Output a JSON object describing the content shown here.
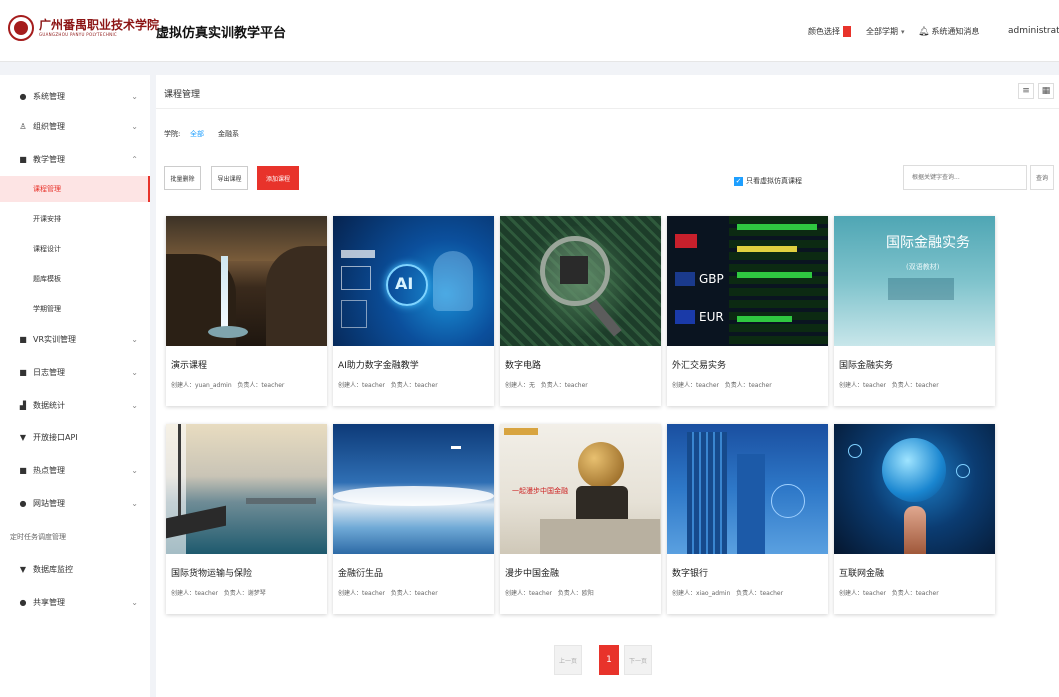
{
  "header": {
    "logo_cn": "广州番禺职业技术学院",
    "logo_en": "GUANGZHOU PANYU POLYTECHNIC",
    "platform_title": "虚拟仿真实训教学平台",
    "color_label": "颜色选择",
    "accent_color": "#e8332b",
    "term_label": "全部学期",
    "notify_label": "系统通知消息",
    "user": "administrator"
  },
  "sidebar": {
    "items": [
      {
        "icon": "circle-icon",
        "label": "系统管理"
      },
      {
        "icon": "user-icon",
        "label": "组织管理"
      },
      {
        "icon": "book-icon",
        "label": "教学管理"
      }
    ],
    "sub_items": [
      "课程管理",
      "开课安排",
      "课程设计",
      "题库模板",
      "学期管理"
    ],
    "more_items": [
      {
        "icon": "vr-icon",
        "label": "VR实训管理"
      },
      {
        "icon": "log-icon",
        "label": "日志管理"
      },
      {
        "icon": "chart-icon",
        "label": "数据统计"
      },
      {
        "icon": "funnel-icon",
        "label": "开放接口API"
      },
      {
        "icon": "hot-icon",
        "label": "热点管理"
      },
      {
        "icon": "web-icon",
        "label": "网站管理"
      }
    ],
    "plain_item": "定时任务调度管理",
    "bottom_items": [
      {
        "icon": "funnel-icon",
        "label": "数据库监控"
      },
      {
        "icon": "share-icon",
        "label": "共享管理"
      }
    ]
  },
  "main": {
    "page_title": "课程管理",
    "filter_label": "学院:",
    "filter_options": [
      "全部",
      "金融系"
    ],
    "buttons": {
      "batch_delete": "批量删除",
      "export": "导出课程",
      "add": "添加课程"
    },
    "checkbox_label": "只看虚拟仿真课程",
    "search_placeholder": "根据关键字查询...",
    "search_button": "查询"
  },
  "courses": [
    {
      "title": "演示课程",
      "creator": "创建人：yuan_admin",
      "owner": "负责人：teacher",
      "image": "waterfall-scene"
    },
    {
      "title": "AI助力数字金融教学",
      "creator": "创建人：teacher",
      "owner": "负责人：teacher",
      "image": "ai-robot-scene"
    },
    {
      "title": "数字电路",
      "creator": "创建人：无",
      "owner": "负责人：teacher",
      "image": "circuit-board-scene"
    },
    {
      "title": "外汇交易实务",
      "creator": "创建人：teacher",
      "owner": "负责人：teacher",
      "image": "forex-board-scene"
    },
    {
      "title": "国际金融实务",
      "creator": "创建人：teacher",
      "owner": "负责人：teacher",
      "image": "book-cover-scene"
    },
    {
      "title": "国际货物运输与保险",
      "creator": "创建人：teacher",
      "owner": "负责人：谢梦琴",
      "image": "sailboat-scene"
    },
    {
      "title": "金融衍生品",
      "creator": "创建人：teacher",
      "owner": "负责人：teacher",
      "image": "sky-water-scene"
    },
    {
      "title": "漫步中国金融",
      "creator": "创建人：teacher",
      "owner": "负责人：欧阳",
      "image": "globe-statue-scene"
    },
    {
      "title": "数字银行",
      "creator": "创建人：xiao_admin",
      "owner": "负责人：teacher",
      "image": "skyscraper-scene"
    },
    {
      "title": "互联网金融",
      "creator": "创建人：teacher",
      "owner": "负责人：teacher",
      "image": "digital-globe-scene"
    }
  ],
  "card_images": {
    "ai_text": "AI",
    "forex_1": "GBP",
    "forex_2": "EUR",
    "book_title": "国际金融实务",
    "book_sub": "(双语教材)",
    "statue_text": "一起漫步中国金融"
  },
  "pagination": {
    "prev": "上一页",
    "current": "1",
    "next": "下一页"
  }
}
